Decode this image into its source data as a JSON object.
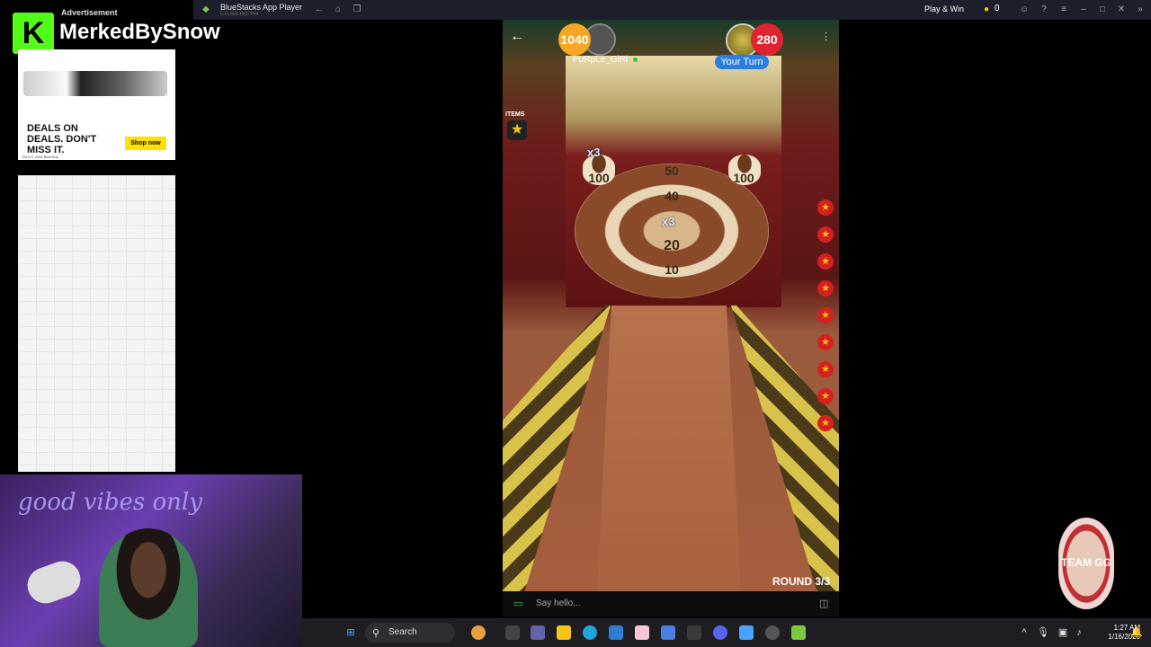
{
  "window": {
    "title": "BlueStacks App Player",
    "subtitle": "5.21.660.1002 P64",
    "play_win": "Play & Win",
    "coins": "0"
  },
  "streamer": {
    "logo_letter": "K",
    "name": "MerkedBySnow"
  },
  "ad": {
    "label": "Advertisement",
    "headline": "DEALS ON DEALS. DON'T MISS IT.",
    "cta": "Shop now",
    "fine": "TM & © 2026 Best Buy"
  },
  "webcam": {
    "neon_text": "good vibes only"
  },
  "game": {
    "player1": {
      "score": "1040",
      "name": "PuRpLe_GiRl"
    },
    "player2": {
      "score": "280"
    },
    "turn_label": "Your Turn",
    "items_label": "ITEMS",
    "targets": {
      "left_cup": "100",
      "right_cup": "100",
      "top": "50",
      "ring40": "40",
      "ring20": "20",
      "ring10": "10",
      "mult_a": "x3",
      "mult_b": "x3"
    },
    "balls_remaining": 9,
    "round": "ROUND 3/3",
    "chat_placeholder": "Say hello..."
  },
  "team_badge": "TEAM GG",
  "taskbar": {
    "search": "Search",
    "time": "1:27 AM",
    "date": "1/16/2026"
  },
  "colors": {
    "p1_badge": "#f5a623",
    "p2_badge": "#e0232e",
    "turn_pill": "#2a7ee0",
    "kick": "#53fc18"
  }
}
